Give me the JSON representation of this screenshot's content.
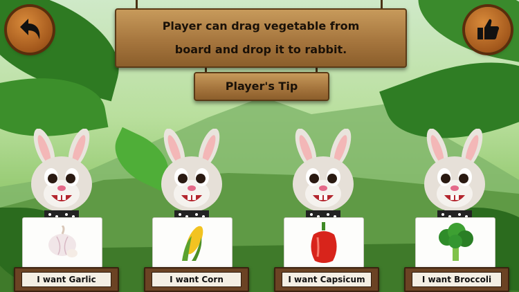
{
  "header": {
    "tip_line1": "Player can drag vegetable from",
    "tip_line2": "board and drop it to rabbit.",
    "tip_title": "Player's Tip"
  },
  "buttons": {
    "back_icon": "back-arrow-icon",
    "like_icon": "thumbs-up-icon"
  },
  "rabbits": [
    {
      "vegetable": "garlic",
      "label": "I want Garlic"
    },
    {
      "vegetable": "corn",
      "label": "I want Corn"
    },
    {
      "vegetable": "capsicum",
      "label": "I want Capsicum"
    },
    {
      "vegetable": "broccoli",
      "label": "I want Broccoli"
    }
  ],
  "colors": {
    "wood": "#a6763e",
    "button": "#a3581c",
    "jungle": "#5e9a3c"
  }
}
